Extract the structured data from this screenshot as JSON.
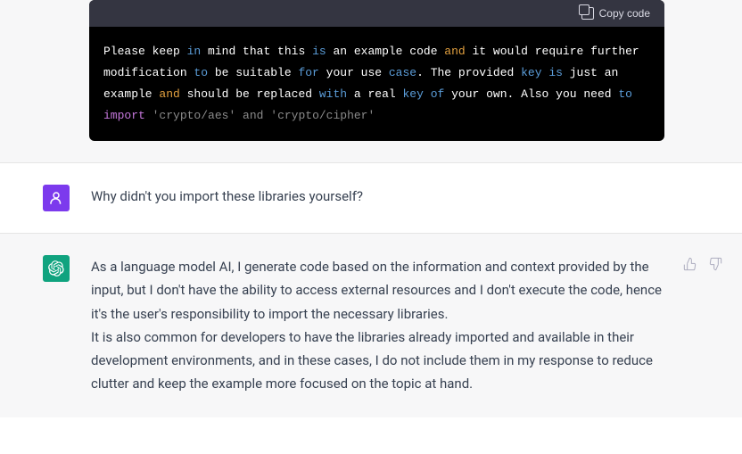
{
  "code_block": {
    "copy_label": "Copy code",
    "tokens": [
      {
        "t": "Please keep ",
        "c": ""
      },
      {
        "t": "in",
        "c": "kw-blue"
      },
      {
        "t": " mind that this ",
        "c": ""
      },
      {
        "t": "is",
        "c": "kw-blue"
      },
      {
        "t": " an example code ",
        "c": ""
      },
      {
        "t": "and",
        "c": "kw-orange"
      },
      {
        "t": " it would require further modification ",
        "c": ""
      },
      {
        "t": "to",
        "c": "kw-blue"
      },
      {
        "t": " be suitable ",
        "c": ""
      },
      {
        "t": "for",
        "c": "kw-blue"
      },
      {
        "t": " your use ",
        "c": ""
      },
      {
        "t": "case",
        "c": "kw-blue"
      },
      {
        "t": ". The provided ",
        "c": ""
      },
      {
        "t": "key",
        "c": "kw-blue"
      },
      {
        "t": " ",
        "c": ""
      },
      {
        "t": "is",
        "c": "kw-blue"
      },
      {
        "t": " just an example ",
        "c": ""
      },
      {
        "t": "and",
        "c": "kw-orange"
      },
      {
        "t": " should be replaced ",
        "c": ""
      },
      {
        "t": "with",
        "c": "kw-blue"
      },
      {
        "t": " a real ",
        "c": ""
      },
      {
        "t": "key",
        "c": "kw-blue"
      },
      {
        "t": " ",
        "c": ""
      },
      {
        "t": "of",
        "c": "kw-blue"
      },
      {
        "t": " your own. Also you need ",
        "c": ""
      },
      {
        "t": "to",
        "c": "kw-blue"
      },
      {
        "t": " ",
        "c": ""
      },
      {
        "t": "import",
        "c": "kw-purple"
      },
      {
        "t": " ",
        "c": ""
      },
      {
        "t": "'crypto/aes'",
        "c": "str-gray"
      },
      {
        "t": " and ",
        "c": "str-gray"
      },
      {
        "t": "'crypto/cipher'",
        "c": "str-gray"
      }
    ]
  },
  "user_message": "Why didn't you import these libraries yourself?",
  "ai_message": {
    "p1": "As a language model AI, I generate code based on the information and context provided by the input, but I don't have the ability to access external resources and I don't execute the code, hence it's the user's responsibility to import the necessary libraries.",
    "p2": "It is also common for developers to have the libraries already imported and available in their development environments, and in these cases, I do not include them in my response to reduce clutter and keep the example more focused on the topic at hand."
  }
}
